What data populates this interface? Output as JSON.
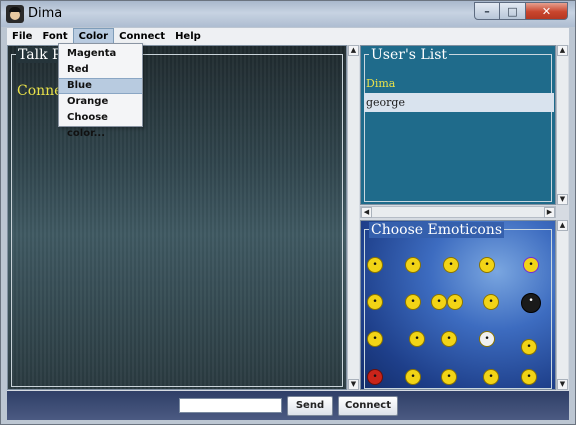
{
  "window": {
    "title": "Dima"
  },
  "menu": {
    "file": "File",
    "font": "Font",
    "color": "Color",
    "connect": "Connect",
    "help": "Help"
  },
  "color_menu": {
    "items": [
      "Magenta",
      "Red",
      "Blue",
      "Orange",
      "Choose color..."
    ],
    "highlighted": "Blue"
  },
  "talk_panel": {
    "title": "Talk Pa",
    "status": "Connect"
  },
  "users_panel": {
    "title": "User's List",
    "users": [
      "Dima",
      "george"
    ]
  },
  "emoticons_panel": {
    "title": "Choose Emoticons"
  },
  "bottom": {
    "message_value": "",
    "send_label": "Send",
    "connect_label": "Connect"
  },
  "colors": {
    "status_text": "#e9e14a",
    "users_panel_bg": "#1f6b8b",
    "selection": "#b8cbe0"
  }
}
